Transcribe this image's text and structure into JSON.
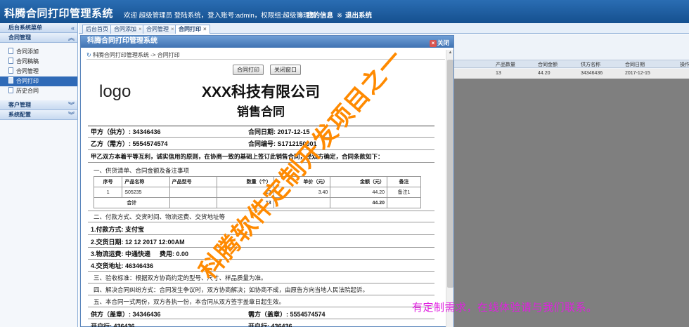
{
  "header": {
    "app_title": "科腾合同打印管理系统",
    "welcome": "欢迎 超级管理员 登陆系统，登入账号:admin，权限组:超级管理员",
    "my_info": "我的信息",
    "logout": "退出系统",
    "bullet": "※"
  },
  "sidebar": {
    "title": "后台系统菜单",
    "sections": {
      "contract": "合同管理",
      "customer": "客户管理",
      "system": "系统配置"
    },
    "items": [
      {
        "label": "合同添加"
      },
      {
        "label": "合同稿稿"
      },
      {
        "label": "合同管理"
      },
      {
        "label": "合同打印"
      },
      {
        "label": "历史合同"
      }
    ]
  },
  "tabs": [
    {
      "label": "后台首页",
      "closable": false
    },
    {
      "label": "合同添加",
      "closable": true
    },
    {
      "label": "合同管理",
      "closable": true
    },
    {
      "label": "合同打印",
      "closable": true
    }
  ],
  "background_grid": {
    "headers": [
      "产品数量",
      "合同金额",
      "供方名称",
      "合同日期",
      "操作"
    ],
    "row": [
      "13",
      "44.20",
      "34346436",
      "2017-12-15"
    ]
  },
  "modal": {
    "title": "科腾合同打印管理系统",
    "close_label": "关闭",
    "breadcrumb": "科腾合同打印管理系统 -> 合同打印",
    "print_button": "合同打印",
    "close_window_button": "关闭窗口"
  },
  "document": {
    "logo": "logo",
    "company": "XXX科技有限公司",
    "title": "销售合同",
    "party_a": "甲方（供方）: 34346436",
    "contract_date": "合同日期: 2017-12-15",
    "party_b": "乙方（需方）: 5554574574",
    "contract_no": "合同编号: S1712150001",
    "intro": "甲乙双方本着平等互利，诚实信用的原则，在协商一致的基础上签订此销售合同，经双方确定，合同条款如下：",
    "section1": "一、供货清单、合同金额及备注事项",
    "table": {
      "headers": [
        "序号",
        "产品名称",
        "产品型号",
        "数量（个）",
        "单价（元）",
        "金额（元）",
        "备注"
      ],
      "rows": [
        [
          "1",
          "S05235",
          "",
          "13",
          "3.40",
          "44.20",
          "备注1"
        ]
      ],
      "total_label": "合计",
      "total_qty": "13",
      "total_amount": "44.20"
    },
    "section2": "二、付款方式、交货时间、物流运费、交货地址等",
    "payment": "1.付款方式: 支付宝",
    "delivery_date": "2.交货日期: 12 12 2017 12:00AM",
    "logistics": "3.物流运费: 中通快递",
    "freight": "费用: 0.00",
    "address": "4.交货地址: 46346436",
    "section3": "三、验收标准：根据双方协商约定的型号、尺寸、样品质量为准。",
    "section4": "四、解决合同纠纷方式：合同发生争议时，双方协商解决；如协商不成，由原告方向当地人民法院起诉。",
    "section5": "五、本合同一式两份，双方各执一份，本合同从双方签字盖章日起生效。",
    "supplier_sign": "供方（盖章）: 34346436",
    "buyer_sign": "需方（盖章）: 5554574574",
    "bank_a": "开户行: 436436",
    "bank_b": "开户行: 436436"
  },
  "watermark": "科腾软件定制开发项目之一",
  "promo": "有定制需求，在线体验请与我们联系。"
}
